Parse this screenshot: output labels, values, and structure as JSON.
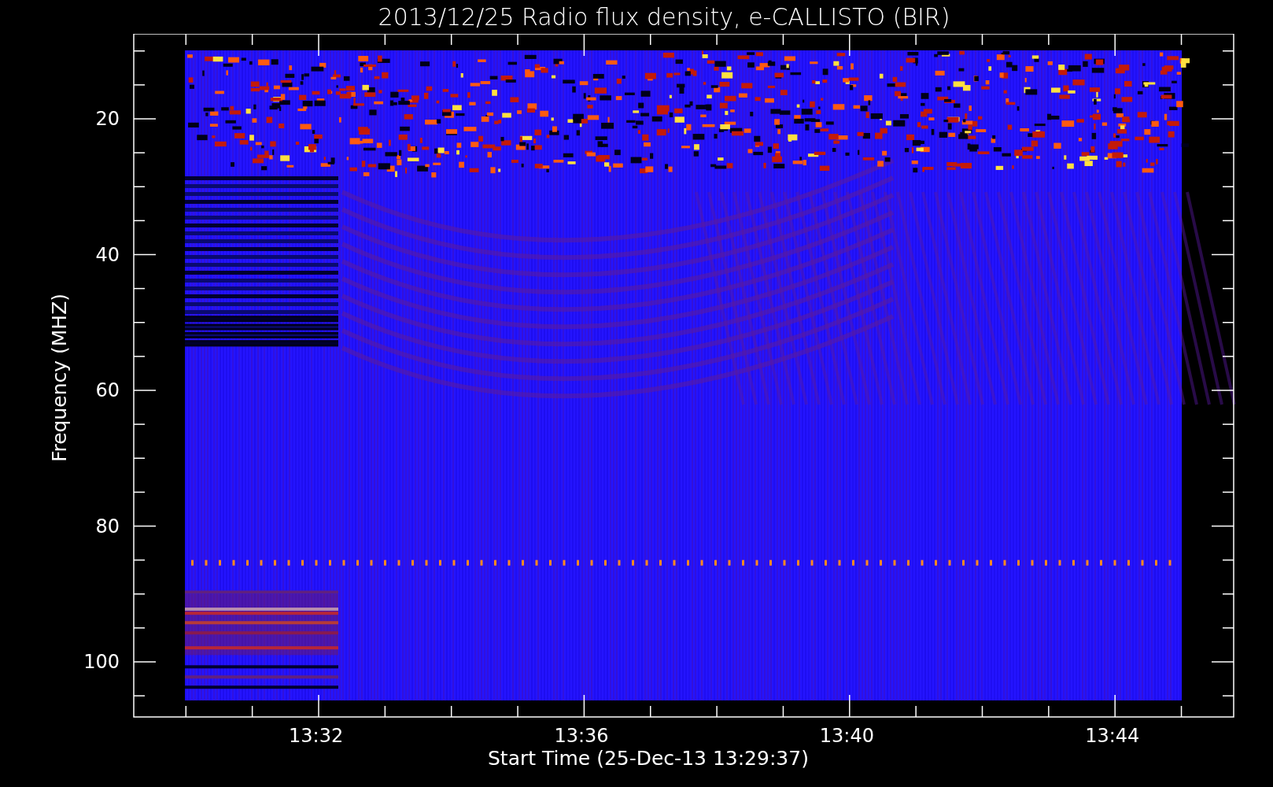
{
  "title": "2013/12/25  Radio flux density, e-CALLISTO (BIR)",
  "y_axis": {
    "label": "Frequency (MHZ)",
    "ticks": [
      "20",
      "40",
      "60",
      "80",
      "100"
    ]
  },
  "x_axis": {
    "label": "Start Time (25-Dec-13 13:29:37)",
    "ticks": [
      "13:32",
      "13:36",
      "13:40",
      "13:44"
    ]
  }
}
